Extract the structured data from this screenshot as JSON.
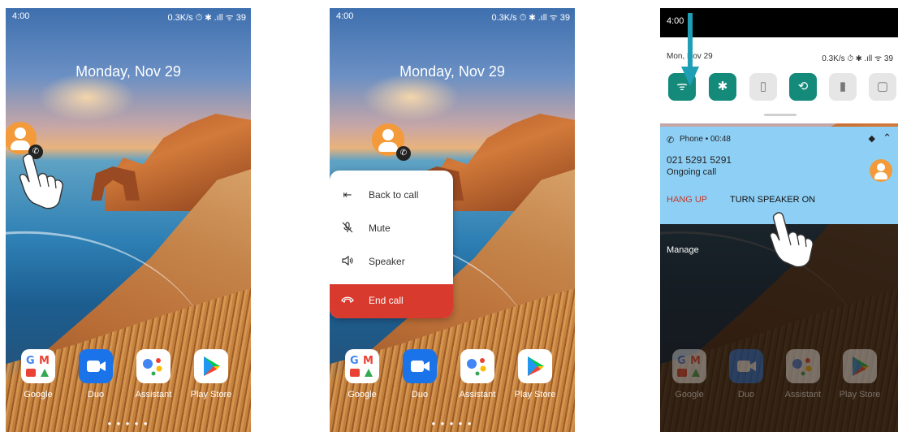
{
  "status_bar": {
    "time": "4:00",
    "net": "0.3K/s ⏱ ✱ .ıll ᯤ 39"
  },
  "lock_date": "Monday, Nov 29",
  "dock": [
    {
      "label": "Google",
      "icon": "google-folder-icon"
    },
    {
      "label": "Duo",
      "icon": "duo-icon"
    },
    {
      "label": "Assistant",
      "icon": "assistant-icon"
    },
    {
      "label": "Play Store",
      "icon": "play-store-icon"
    }
  ],
  "call_menu": {
    "items": [
      {
        "label": "Back to call",
        "icon": "back-to-call-icon"
      },
      {
        "label": "Mute",
        "icon": "mute-icon"
      },
      {
        "label": "Speaker",
        "icon": "speaker-icon"
      }
    ],
    "end": {
      "label": "End call",
      "icon": "end-call-icon"
    }
  },
  "shade": {
    "date": "Mon, Nov 29",
    "tiles": [
      "wifi",
      "bluetooth",
      "flashlight",
      "auto-rotate",
      "battery-saver",
      "screen-cast"
    ],
    "notification": {
      "app": "Phone • 00:48",
      "number": "021 5291 5291",
      "state": "Ongoing call",
      "hang_up": "HANG UP",
      "speaker": "TURN SPEAKER ON"
    },
    "manage": "Manage"
  },
  "colors": {
    "teal": "#148a7a",
    "end_red": "#d93a2e",
    "avatar": "#f39a3a",
    "notif_bg": "#8ed0f5",
    "hang_up": "#c0392b"
  }
}
